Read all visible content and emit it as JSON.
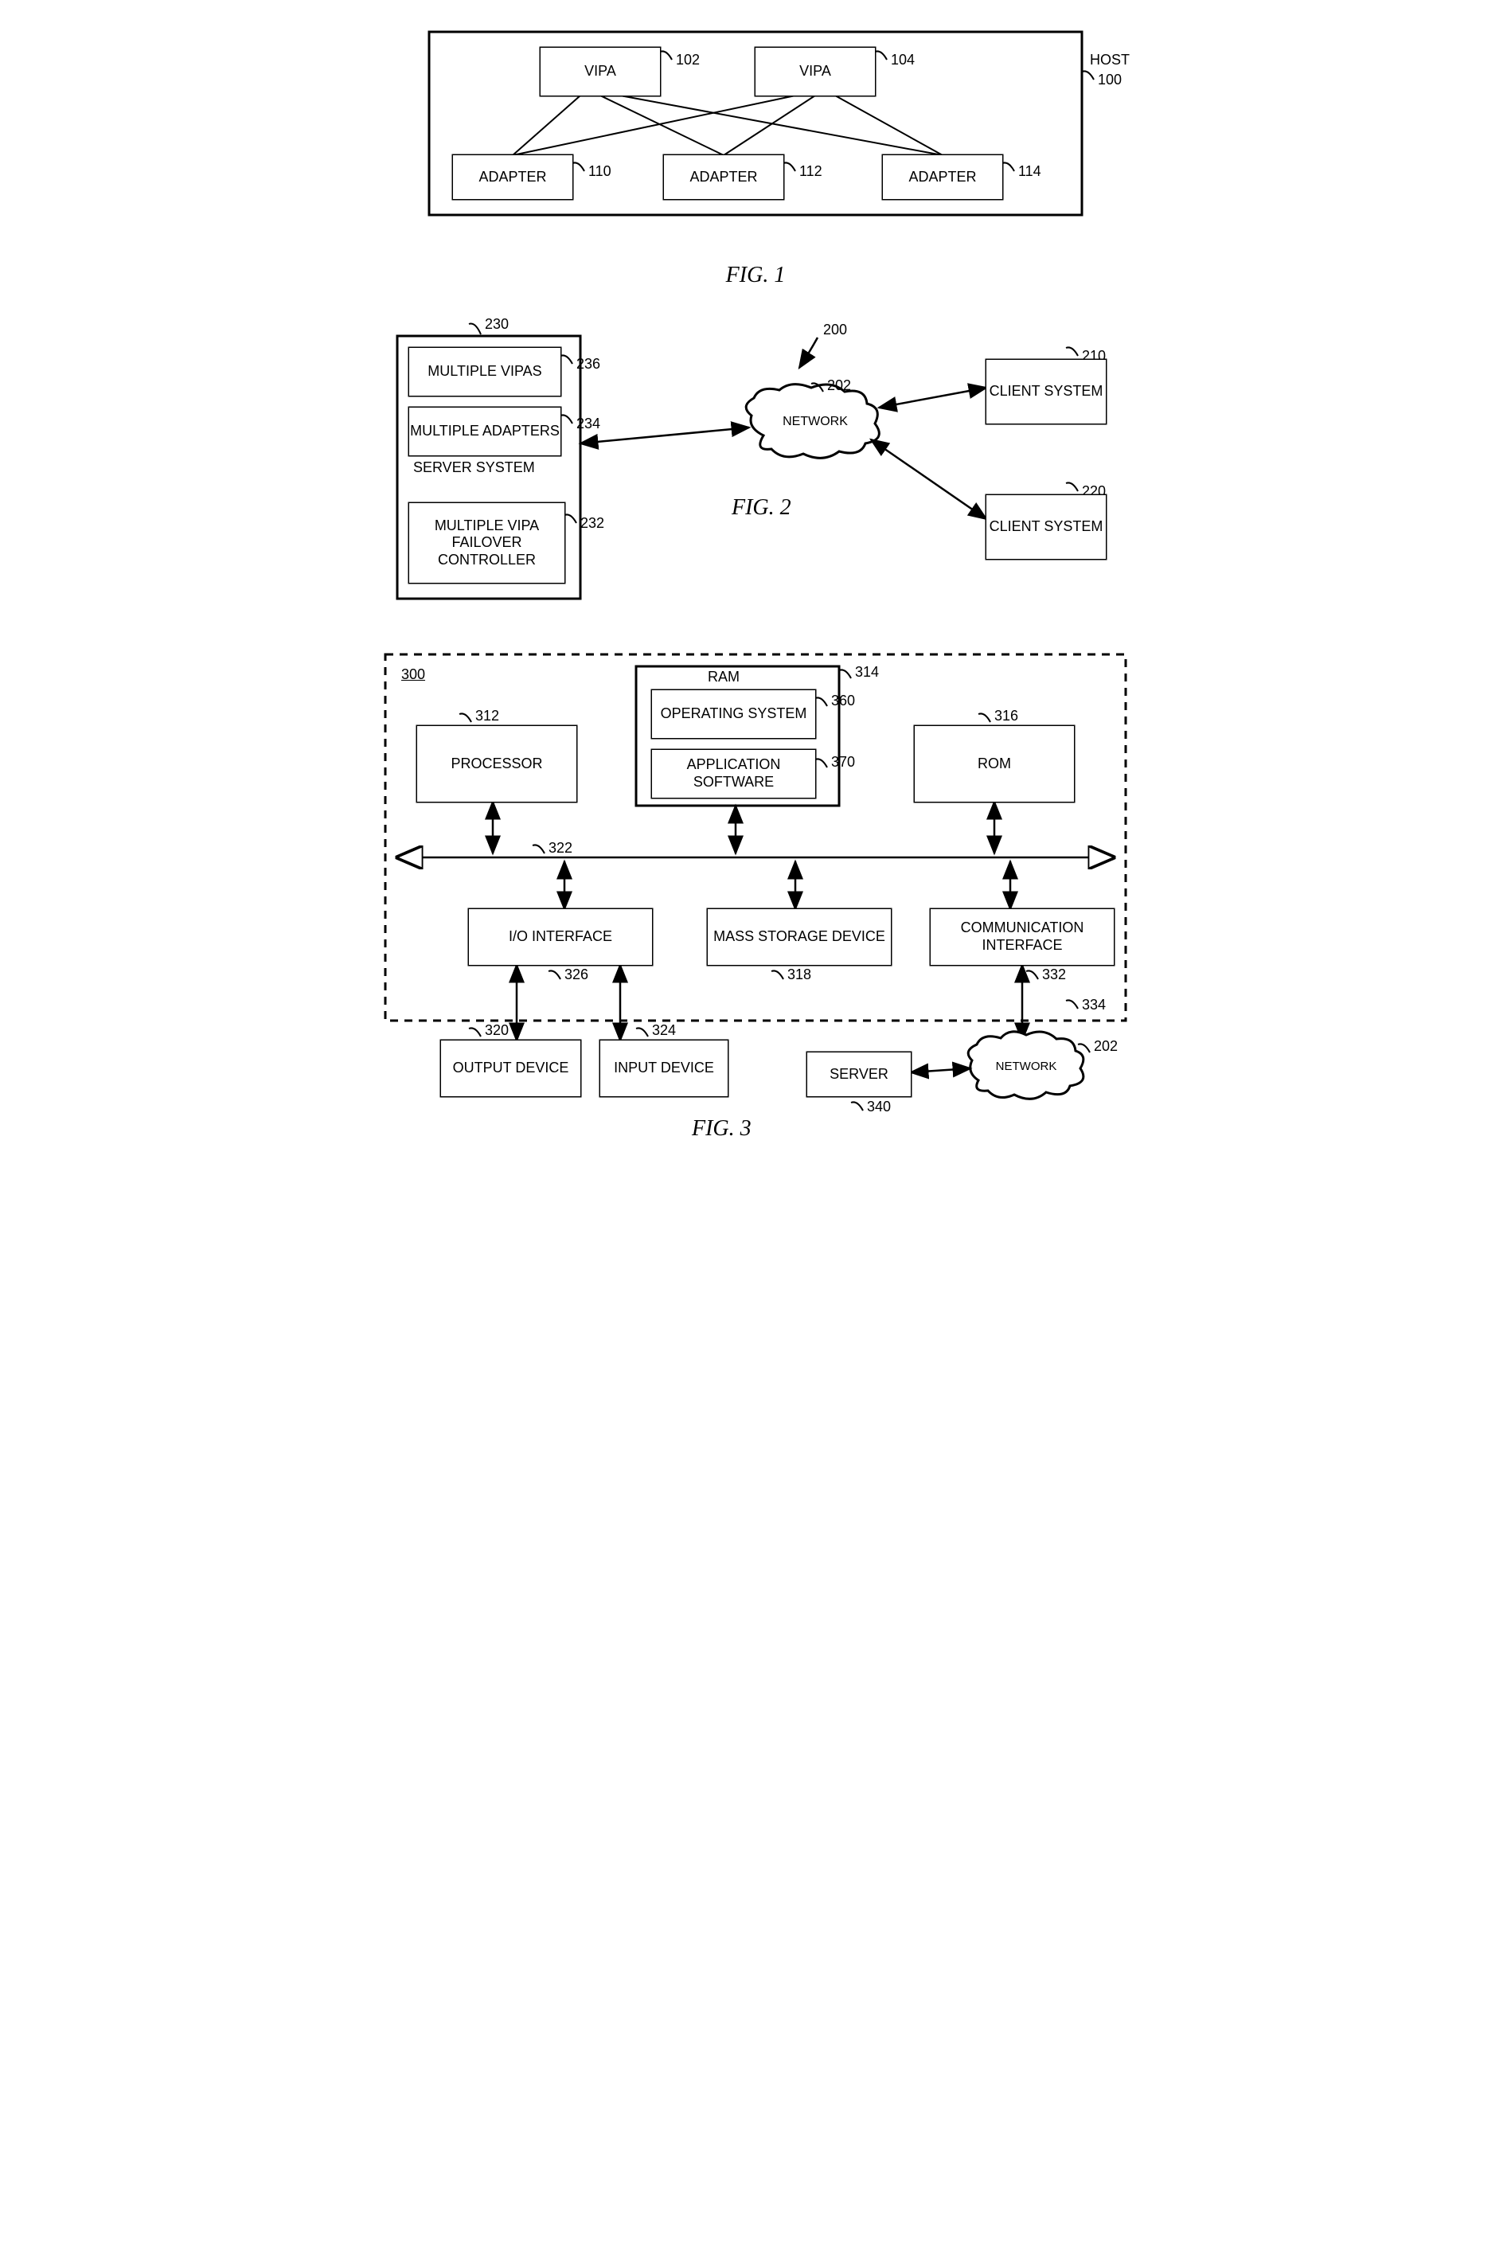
{
  "fig1": {
    "caption": "FIG. 1",
    "host_label": "HOST",
    "host_ref": "100",
    "vipa1": "VIPA",
    "vipa1_ref": "102",
    "vipa2": "VIPA",
    "vipa2_ref": "104",
    "adapter1": "ADAPTER",
    "adapter1_ref": "110",
    "adapter2": "ADAPTER",
    "adapter2_ref": "112",
    "adapter3": "ADAPTER",
    "adapter3_ref": "114"
  },
  "fig2": {
    "caption": "FIG. 2",
    "ref200": "200",
    "server_ref": "230",
    "server_label": "SERVER SYSTEM",
    "vipas": "MULTIPLE VIPAS",
    "vipas_ref": "236",
    "adapters": "MULTIPLE ADAPTERS",
    "adapters_ref": "234",
    "failover": "MULTIPLE VIPA FAILOVER CONTROLLER",
    "failover_ref": "232",
    "network": "NETWORK",
    "network_ref": "202",
    "client1": "CLIENT SYSTEM",
    "client1_ref": "210",
    "client2": "CLIENT SYSTEM",
    "client2_ref": "220"
  },
  "fig3": {
    "caption": "FIG. 3",
    "ref300": "300",
    "processor": "PROCESSOR",
    "processor_ref": "312",
    "ram": "RAM",
    "ram_ref": "314",
    "os": "OPERATING SYSTEM",
    "os_ref": "360",
    "app": "APPLICATION SOFTWARE",
    "app_ref": "370",
    "rom": "ROM",
    "rom_ref": "316",
    "bus_ref": "322",
    "io": "I/O INTERFACE",
    "io_ref": "326",
    "mass": "MASS STORAGE DEVICE",
    "mass_ref": "318",
    "comm": "COMMUNICATION INTERFACE",
    "comm_ref": "332",
    "outdev": "OUTPUT DEVICE",
    "outdev_ref": "320",
    "indev": "INPUT DEVICE",
    "indev_ref": "324",
    "server": "SERVER",
    "server_ref": "340",
    "network": "NETWORK",
    "network_ref": "202",
    "link_ref": "334"
  }
}
